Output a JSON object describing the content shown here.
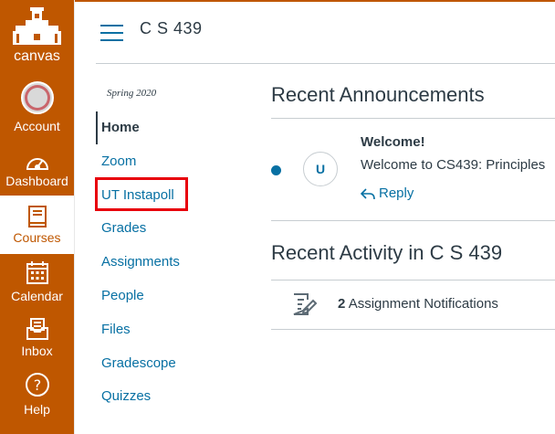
{
  "brand": {
    "logo_text": "canvas",
    "rail_color": "#bf5700",
    "link_color": "#0770a3",
    "highlight_color": "#e8000b"
  },
  "global_nav": [
    {
      "label": "Account",
      "icon": "account-avatar-icon"
    },
    {
      "label": "Dashboard",
      "icon": "dashboard-gauge-icon"
    },
    {
      "label": "Courses",
      "icon": "book-icon",
      "active": true
    },
    {
      "label": "Calendar",
      "icon": "calendar-icon"
    },
    {
      "label": "Inbox",
      "icon": "inbox-icon"
    },
    {
      "label": "Help",
      "icon": "help-question-icon"
    }
  ],
  "header": {
    "course_title": "C S 439"
  },
  "course_nav": {
    "term": "Spring 2020",
    "items": [
      {
        "label": "Home",
        "current": true
      },
      {
        "label": "Zoom"
      },
      {
        "label": "UT Instapoll",
        "highlighted": true
      },
      {
        "label": "Grades"
      },
      {
        "label": "Assignments"
      },
      {
        "label": "People"
      },
      {
        "label": "Files"
      },
      {
        "label": "Gradescope"
      },
      {
        "label": "Quizzes"
      }
    ]
  },
  "announcements": {
    "heading": "Recent Announcements",
    "items": [
      {
        "avatar_initial": "U",
        "title": "Welcome!",
        "body": "Welcome to CS439: Principles",
        "reply_label": "Reply",
        "unread": true
      }
    ]
  },
  "activity": {
    "heading": "Recent Activity in C S 439",
    "items": [
      {
        "count": "2",
        "label": "Assignment Notifications",
        "icon": "assignment-edit-icon"
      }
    ]
  }
}
